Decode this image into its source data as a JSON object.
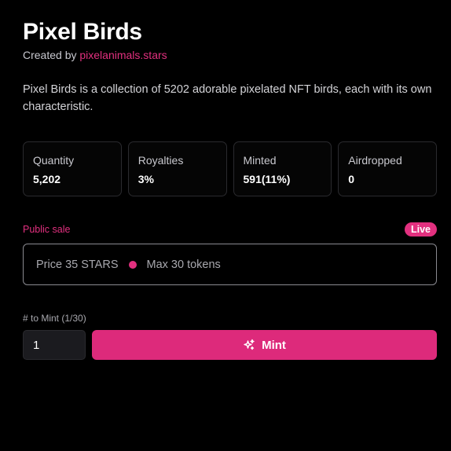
{
  "collection": {
    "title": "Pixel Birds",
    "created_by_prefix": "Created by ",
    "creator": "pixelanimals.stars",
    "description": "Pixel Birds is a collection of 5202 adorable pixelated NFT birds, each with its own characteristic."
  },
  "stats": [
    {
      "label": "Quantity",
      "value": "5,202"
    },
    {
      "label": "Royalties",
      "value": "3%"
    },
    {
      "label": "Minted",
      "value": "591(11%)"
    },
    {
      "label": "Airdropped",
      "value": "0"
    }
  ],
  "sale": {
    "label": "Public sale",
    "status": "Live",
    "price": "Price 35 STARS",
    "max": "Max 30 tokens"
  },
  "mint": {
    "label": "# to Mint (1/30)",
    "quantity": "1",
    "button_label": "Mint",
    "button_icon": "sparkles-icon"
  },
  "colors": {
    "accent": "#e2307f",
    "background": "#000000",
    "card_border": "#2a2a2e"
  }
}
